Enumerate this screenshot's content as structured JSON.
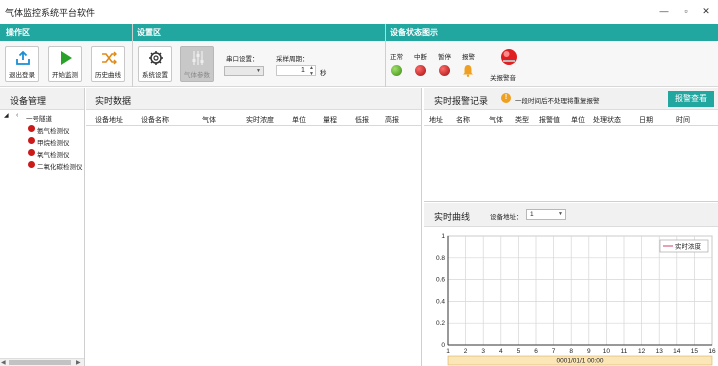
{
  "window": {
    "title": "气体监控系统平台软件",
    "min_glyph": "—",
    "max_glyph": "▫",
    "close_glyph": "✕"
  },
  "sections": {
    "ops": "操作区",
    "settings": "设置区",
    "status": "设备状态图示"
  },
  "toolbar": {
    "logout": "退出登录",
    "start": "开始监测",
    "history": "历史曲线",
    "system_settings": "系统设置",
    "gas_params": "气体参数",
    "serial_label": "串口设置：",
    "serial_value": "",
    "period_label": "采样周期：",
    "period_value": "1",
    "period_unit": "秒"
  },
  "status_legend": {
    "normal": "正常",
    "interrupt": "中断",
    "pause": "暂停",
    "alarm": "报警",
    "close_alarm": "关报警音",
    "colors": {
      "normal": "#5aa81a",
      "interrupt": "#cc1a1a",
      "pause": "#cc1a1a",
      "alarm": "#f0a020"
    }
  },
  "device_panel": {
    "title": "设备管理",
    "root": "一号隧道",
    "items": [
      "氨气检测仪",
      "甲烷检测仪",
      "氧气检测仪",
      "二氧化碳检测仪"
    ]
  },
  "realtime": {
    "title": "实时数据",
    "columns": [
      "设备地址",
      "设备名称",
      "气体",
      "实时浓度",
      "单位",
      "量程",
      "低报",
      "高报"
    ]
  },
  "alarm_log": {
    "title": "实时报警记录",
    "note": "一段时间后不处理将重复报警",
    "view_button": "报警查看",
    "columns": [
      "地址",
      "名称",
      "气体",
      "类型",
      "报警值",
      "单位",
      "处理状态",
      "日期",
      "时间"
    ]
  },
  "curve": {
    "title": "实时曲线",
    "addr_label": "设备地址：",
    "addr_value": "1",
    "legend": "实时浓度",
    "date_label": "0001/01/1  00:00"
  },
  "chart_data": {
    "type": "line",
    "title": "",
    "xlabel": "",
    "ylabel": "",
    "x_ticks": [
      "1",
      "2",
      "3",
      "4",
      "5",
      "6",
      "7",
      "8",
      "9",
      "10",
      "11",
      "12",
      "13",
      "14",
      "15",
      "16"
    ],
    "y_ticks": [
      "0",
      "0.2",
      "0.4",
      "0.6",
      "0.8",
      "1"
    ],
    "xlim": [
      1,
      16
    ],
    "ylim": [
      0,
      1
    ],
    "grid": true,
    "legend_position": "top-right",
    "series": [
      {
        "name": "实时浓度",
        "color": "#cc4466",
        "x": [],
        "y": []
      }
    ]
  }
}
